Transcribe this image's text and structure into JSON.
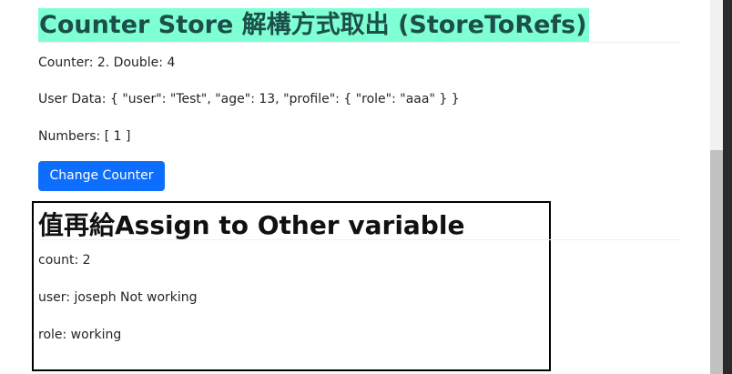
{
  "store_section": {
    "heading": "Counter Store 解構方式取出 (StoreToRefs)",
    "counter_line": "Counter: 2. Double: 4",
    "user_data_line": "User Data: { \"user\": \"Test\", \"age\": 13, \"profile\": { \"role\": \"aaa\" } }",
    "numbers_line": "Numbers: [ 1 ]",
    "change_button_label": "Change Counter"
  },
  "assign_section": {
    "heading": "值再給Assign to Other variable",
    "count_line": "count: 2",
    "user_line": "user: joseph Not working",
    "role_line": "role: working"
  },
  "colors": {
    "heading_highlight": "#7fffd4",
    "heading_text": "#1d4f49",
    "button": "#0d6efd"
  }
}
